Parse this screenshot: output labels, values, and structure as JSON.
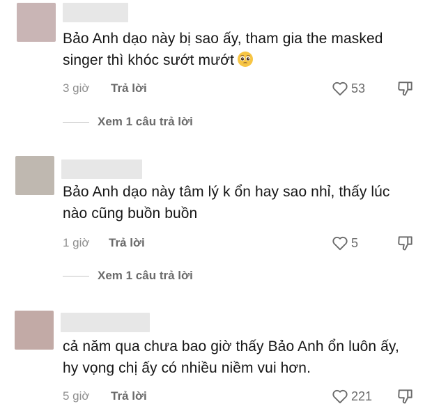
{
  "comments": [
    {
      "text": "Bảo Anh dạo này bị sao ấy, tham gia the masked singer thì khóc sướt mướt",
      "emoji": "pleading-face",
      "time": "3 giờ",
      "reply_label": "Trả lời",
      "likes": "53",
      "view_replies": "Xem 1 câu trả lời",
      "avatar_color": "#c9b5b5"
    },
    {
      "text": "Bảo Anh dạo này tâm lý k ổn hay sao nhỉ, thấy lúc nào cũng buồn buồn",
      "time": "1 giờ",
      "reply_label": "Trả lời",
      "likes": "5",
      "view_replies": "Xem 1 câu trả lời",
      "avatar_color": "#bfb8b0"
    },
    {
      "text": "cả năm qua chưa bao giờ thấy Bảo Anh ổn luôn ấy, hy vọng chị ấy có nhiều niềm vui hơn.",
      "time": "5 giờ",
      "reply_label": "Trả lời",
      "likes": "221",
      "avatar_color": "#c2aaa6"
    }
  ],
  "icons": {
    "like": "heart-outline-icon",
    "dislike": "thumbs-down-outline-icon"
  },
  "colors": {
    "text": "#161616",
    "meta": "#8f8f8f",
    "action": "#6a6a6a",
    "placeholder": "#e7e7e7"
  }
}
